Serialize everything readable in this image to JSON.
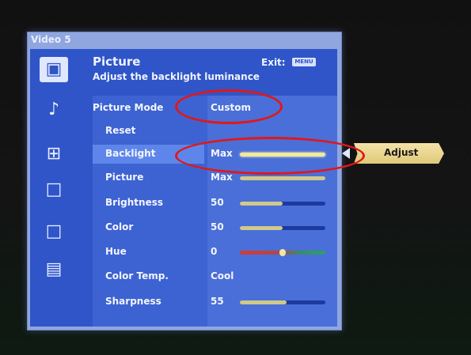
{
  "source": "Video 5",
  "header": {
    "title": "Picture",
    "subtitle": "Adjust the backlight luminance",
    "exit_label": "Exit:",
    "exit_key": "MENU"
  },
  "sidebar": {
    "icons": [
      "picture-icon",
      "music-note-icon",
      "screen-adjust-icon",
      "tv-setup-icon",
      "lock-icon",
      "options-list-icon"
    ]
  },
  "menu": {
    "picture_mode": {
      "label": "Picture Mode",
      "value": "Custom"
    },
    "reset": {
      "label": "Reset"
    },
    "backlight": {
      "label": "Backlight",
      "value": "Max",
      "level": 100
    },
    "picture": {
      "label": "Picture",
      "value": "Max",
      "level": 100
    },
    "brightness": {
      "label": "Brightness",
      "value": "50",
      "level": 50
    },
    "color": {
      "label": "Color",
      "value": "50",
      "level": 50
    },
    "hue": {
      "label": "Hue",
      "value": "0",
      "level": 50
    },
    "color_temp": {
      "label": "Color Temp.",
      "value": "Cool"
    },
    "sharpness": {
      "label": "Sharpness",
      "value": "55",
      "level": 55
    }
  },
  "submenu": {
    "label": "Adjust"
  },
  "colors": {
    "panel": "#2f55c8",
    "highlight": "#5e86ea",
    "slider_fill": "#cfc98a",
    "annotation": "#e01818",
    "submenu": "#e8d48e"
  }
}
